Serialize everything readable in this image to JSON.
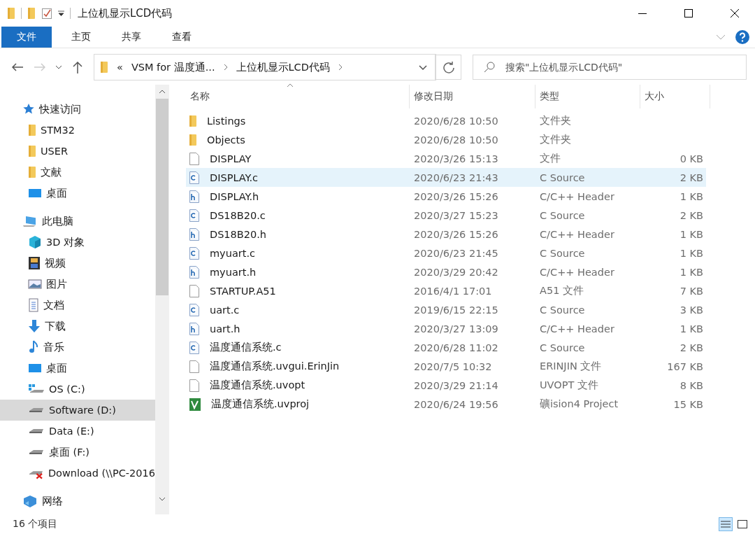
{
  "window": {
    "title": "上位机显示LCD代码"
  },
  "ribbon": {
    "tabs": [
      {
        "label": "文件",
        "selected": true
      },
      {
        "label": "主页",
        "selected": false
      },
      {
        "label": "共享",
        "selected": false
      },
      {
        "label": "查看",
        "selected": false
      }
    ]
  },
  "address": {
    "overflow": "«",
    "crumbs": [
      "VSM for 温度通...",
      "上位机显示LCD代码"
    ]
  },
  "search": {
    "placeholder": "搜索\"上位机显示LCD代码\""
  },
  "sidebar": {
    "items": [
      {
        "label": "快速访问",
        "kind": "star",
        "selected": false,
        "children": [
          {
            "label": "STM32",
            "kind": "folder",
            "selected": false
          },
          {
            "label": "USER",
            "kind": "folder",
            "selected": false
          },
          {
            "label": "文献",
            "kind": "folder",
            "selected": false
          },
          {
            "label": "桌面",
            "kind": "desktop",
            "selected": false
          }
        ]
      },
      {
        "label": "此电脑",
        "kind": "pc",
        "selected": false,
        "children": [
          {
            "label": "3D 对象",
            "kind": "cube",
            "selected": false
          },
          {
            "label": "视频",
            "kind": "video",
            "selected": false
          },
          {
            "label": "图片",
            "kind": "picture",
            "selected": false
          },
          {
            "label": "文档",
            "kind": "doc",
            "selected": false
          },
          {
            "label": "下载",
            "kind": "download",
            "selected": false
          },
          {
            "label": "音乐",
            "kind": "music",
            "selected": false
          },
          {
            "label": "桌面",
            "kind": "desktop",
            "selected": false
          },
          {
            "label": "OS (C:)",
            "kind": "drive-os",
            "selected": false
          },
          {
            "label": "Software (D:)",
            "kind": "drive",
            "selected": true
          },
          {
            "label": "Data (E:)",
            "kind": "drive",
            "selected": false
          },
          {
            "label": "桌面 (F:)",
            "kind": "drive",
            "selected": false
          },
          {
            "label": "Download (\\\\PC-2016",
            "kind": "drive-net",
            "selected": false
          }
        ]
      },
      {
        "label": "网络",
        "kind": "network",
        "selected": false
      }
    ]
  },
  "table": {
    "columns": [
      "名称",
      "修改日期",
      "类型",
      "大小"
    ],
    "rows": [
      {
        "name": "Listings",
        "kind": "folder",
        "date": "2020/6/28 10:50",
        "type": "文件夹",
        "size": "",
        "selected": false
      },
      {
        "name": "Objects",
        "kind": "folder",
        "date": "2020/6/28 10:50",
        "type": "文件夹",
        "size": "",
        "selected": false
      },
      {
        "name": "DISPLAY",
        "kind": "file",
        "date": "2020/3/26 15:13",
        "type": "文件",
        "size": "0 KB",
        "selected": false
      },
      {
        "name": "DISPLAY.c",
        "kind": "c",
        "date": "2020/6/23 21:43",
        "type": "C Source",
        "size": "2 KB",
        "selected": true
      },
      {
        "name": "DISPLAY.h",
        "kind": "h",
        "date": "2020/3/26 15:26",
        "type": "C/C++ Header",
        "size": "1 KB",
        "selected": false
      },
      {
        "name": "DS18B20.c",
        "kind": "c",
        "date": "2020/3/27 15:23",
        "type": "C Source",
        "size": "2 KB",
        "selected": false
      },
      {
        "name": "DS18B20.h",
        "kind": "h",
        "date": "2020/3/26 15:26",
        "type": "C/C++ Header",
        "size": "1 KB",
        "selected": false
      },
      {
        "name": "myuart.c",
        "kind": "c",
        "date": "2020/6/23 21:45",
        "type": "C Source",
        "size": "1 KB",
        "selected": false
      },
      {
        "name": "myuart.h",
        "kind": "h",
        "date": "2020/3/29 20:42",
        "type": "C/C++ Header",
        "size": "1 KB",
        "selected": false
      },
      {
        "name": "STARTUP.A51",
        "kind": "file",
        "date": "2016/4/1 17:01",
        "type": "A51 文件",
        "size": "7 KB",
        "selected": false
      },
      {
        "name": "uart.c",
        "kind": "c",
        "date": "2019/6/15 22:15",
        "type": "C Source",
        "size": "3 KB",
        "selected": false
      },
      {
        "name": "uart.h",
        "kind": "h",
        "date": "2020/3/27 13:09",
        "type": "C/C++ Header",
        "size": "1 KB",
        "selected": false
      },
      {
        "name": "温度通信系统.c",
        "kind": "c",
        "date": "2020/6/28 11:02",
        "type": "C Source",
        "size": "2 KB",
        "selected": false
      },
      {
        "name": "温度通信系统.uvgui.ErinJin",
        "kind": "file",
        "date": "2020/7/5 10:32",
        "type": "ERINJIN 文件",
        "size": "167 KB",
        "selected": false
      },
      {
        "name": "温度通信系统.uvopt",
        "kind": "file",
        "date": "2020/3/29 21:14",
        "type": "UVOPT 文件",
        "size": "8 KB",
        "selected": false
      },
      {
        "name": "温度通信系统.uvproj",
        "kind": "project",
        "date": "2020/6/24 19:56",
        "type": "礦ision4 Project",
        "size": "15 KB",
        "selected": false
      }
    ]
  },
  "status_bar": {
    "count": "16 个项目"
  }
}
